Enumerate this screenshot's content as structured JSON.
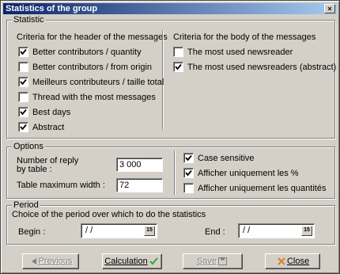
{
  "window": {
    "title": "Statistics of the group",
    "close_glyph": "×"
  },
  "statistic": {
    "title": "Statistic",
    "header_criteria_title": "Criteria for the header of the messages",
    "body_criteria_title": "Criteria for the body of the messages",
    "header_items": [
      {
        "label": "Better contributors / quantity",
        "checked": true
      },
      {
        "label": "Better contributors / from origin",
        "checked": false
      },
      {
        "label": "Meilleurs contributeurs / taille total",
        "checked": true
      },
      {
        "label": "Thread with the most messages",
        "checked": false
      },
      {
        "label": "Best days",
        "checked": true
      },
      {
        "label": "Abstract",
        "checked": true
      }
    ],
    "body_items": [
      {
        "label": "The most used newsreader",
        "checked": false
      },
      {
        "label": "The most used newsreaders (abstract)",
        "checked": true
      }
    ]
  },
  "options": {
    "title": "Options",
    "reply_label_line1": "Number of reply",
    "reply_label_line2": "by table :",
    "reply_value": "3 000",
    "width_label": "Table maximum width :",
    "width_value": "72",
    "checks": [
      {
        "label": "Case sensitive",
        "checked": true
      },
      {
        "label": "Afficher uniquement les %",
        "checked": true
      },
      {
        "label": "Afficher uniquement les quantités",
        "checked": false
      }
    ]
  },
  "period": {
    "title": "Period",
    "description": "Choice of the period over which to do the statistics",
    "begin_label": "Begin :",
    "begin_value": "/ /",
    "end_label": "End :",
    "end_value": "/ /",
    "calendar_glyph": "15"
  },
  "buttons": {
    "previous": "Previous",
    "calculation": "Calculation",
    "save": "Save",
    "close": "Close"
  },
  "colors": {
    "title_start": "#0a246a",
    "title_end": "#a6caf0",
    "check_green": "#3aa53a",
    "close_red": "#e08020"
  }
}
